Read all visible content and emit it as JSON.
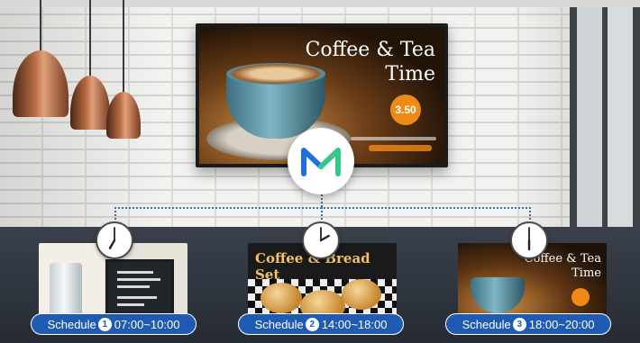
{
  "main_display": {
    "title_line1": "Coffee & Tea",
    "title_line2": "Time",
    "price": "3.50"
  },
  "schedules": [
    {
      "label": "Schedule",
      "number": "1",
      "time": "07:00~10:00",
      "clock_hour": 7,
      "clock_minute": 0
    },
    {
      "label": "Schedule",
      "number": "2",
      "time": "14:00~18:00",
      "clock_hour": 14,
      "clock_minute": 0
    },
    {
      "label": "Schedule",
      "number": "3",
      "time": "18:00~20:00",
      "clock_hour": 18,
      "clock_minute": 0
    }
  ],
  "mini_screens": {
    "screen2_title": "Coffee & Bread Set",
    "screen3_title_line1": "Coffee & Tea",
    "screen3_title_line2": "Time"
  },
  "colors": {
    "accent_blue": "#1f5bb3",
    "price_orange": "#f08a16",
    "logo_blue": "#1e6fe0",
    "logo_green": "#34c88a"
  },
  "icons": {
    "logo": "magicinfo-m-logo-icon",
    "clock": "clock-icon"
  }
}
